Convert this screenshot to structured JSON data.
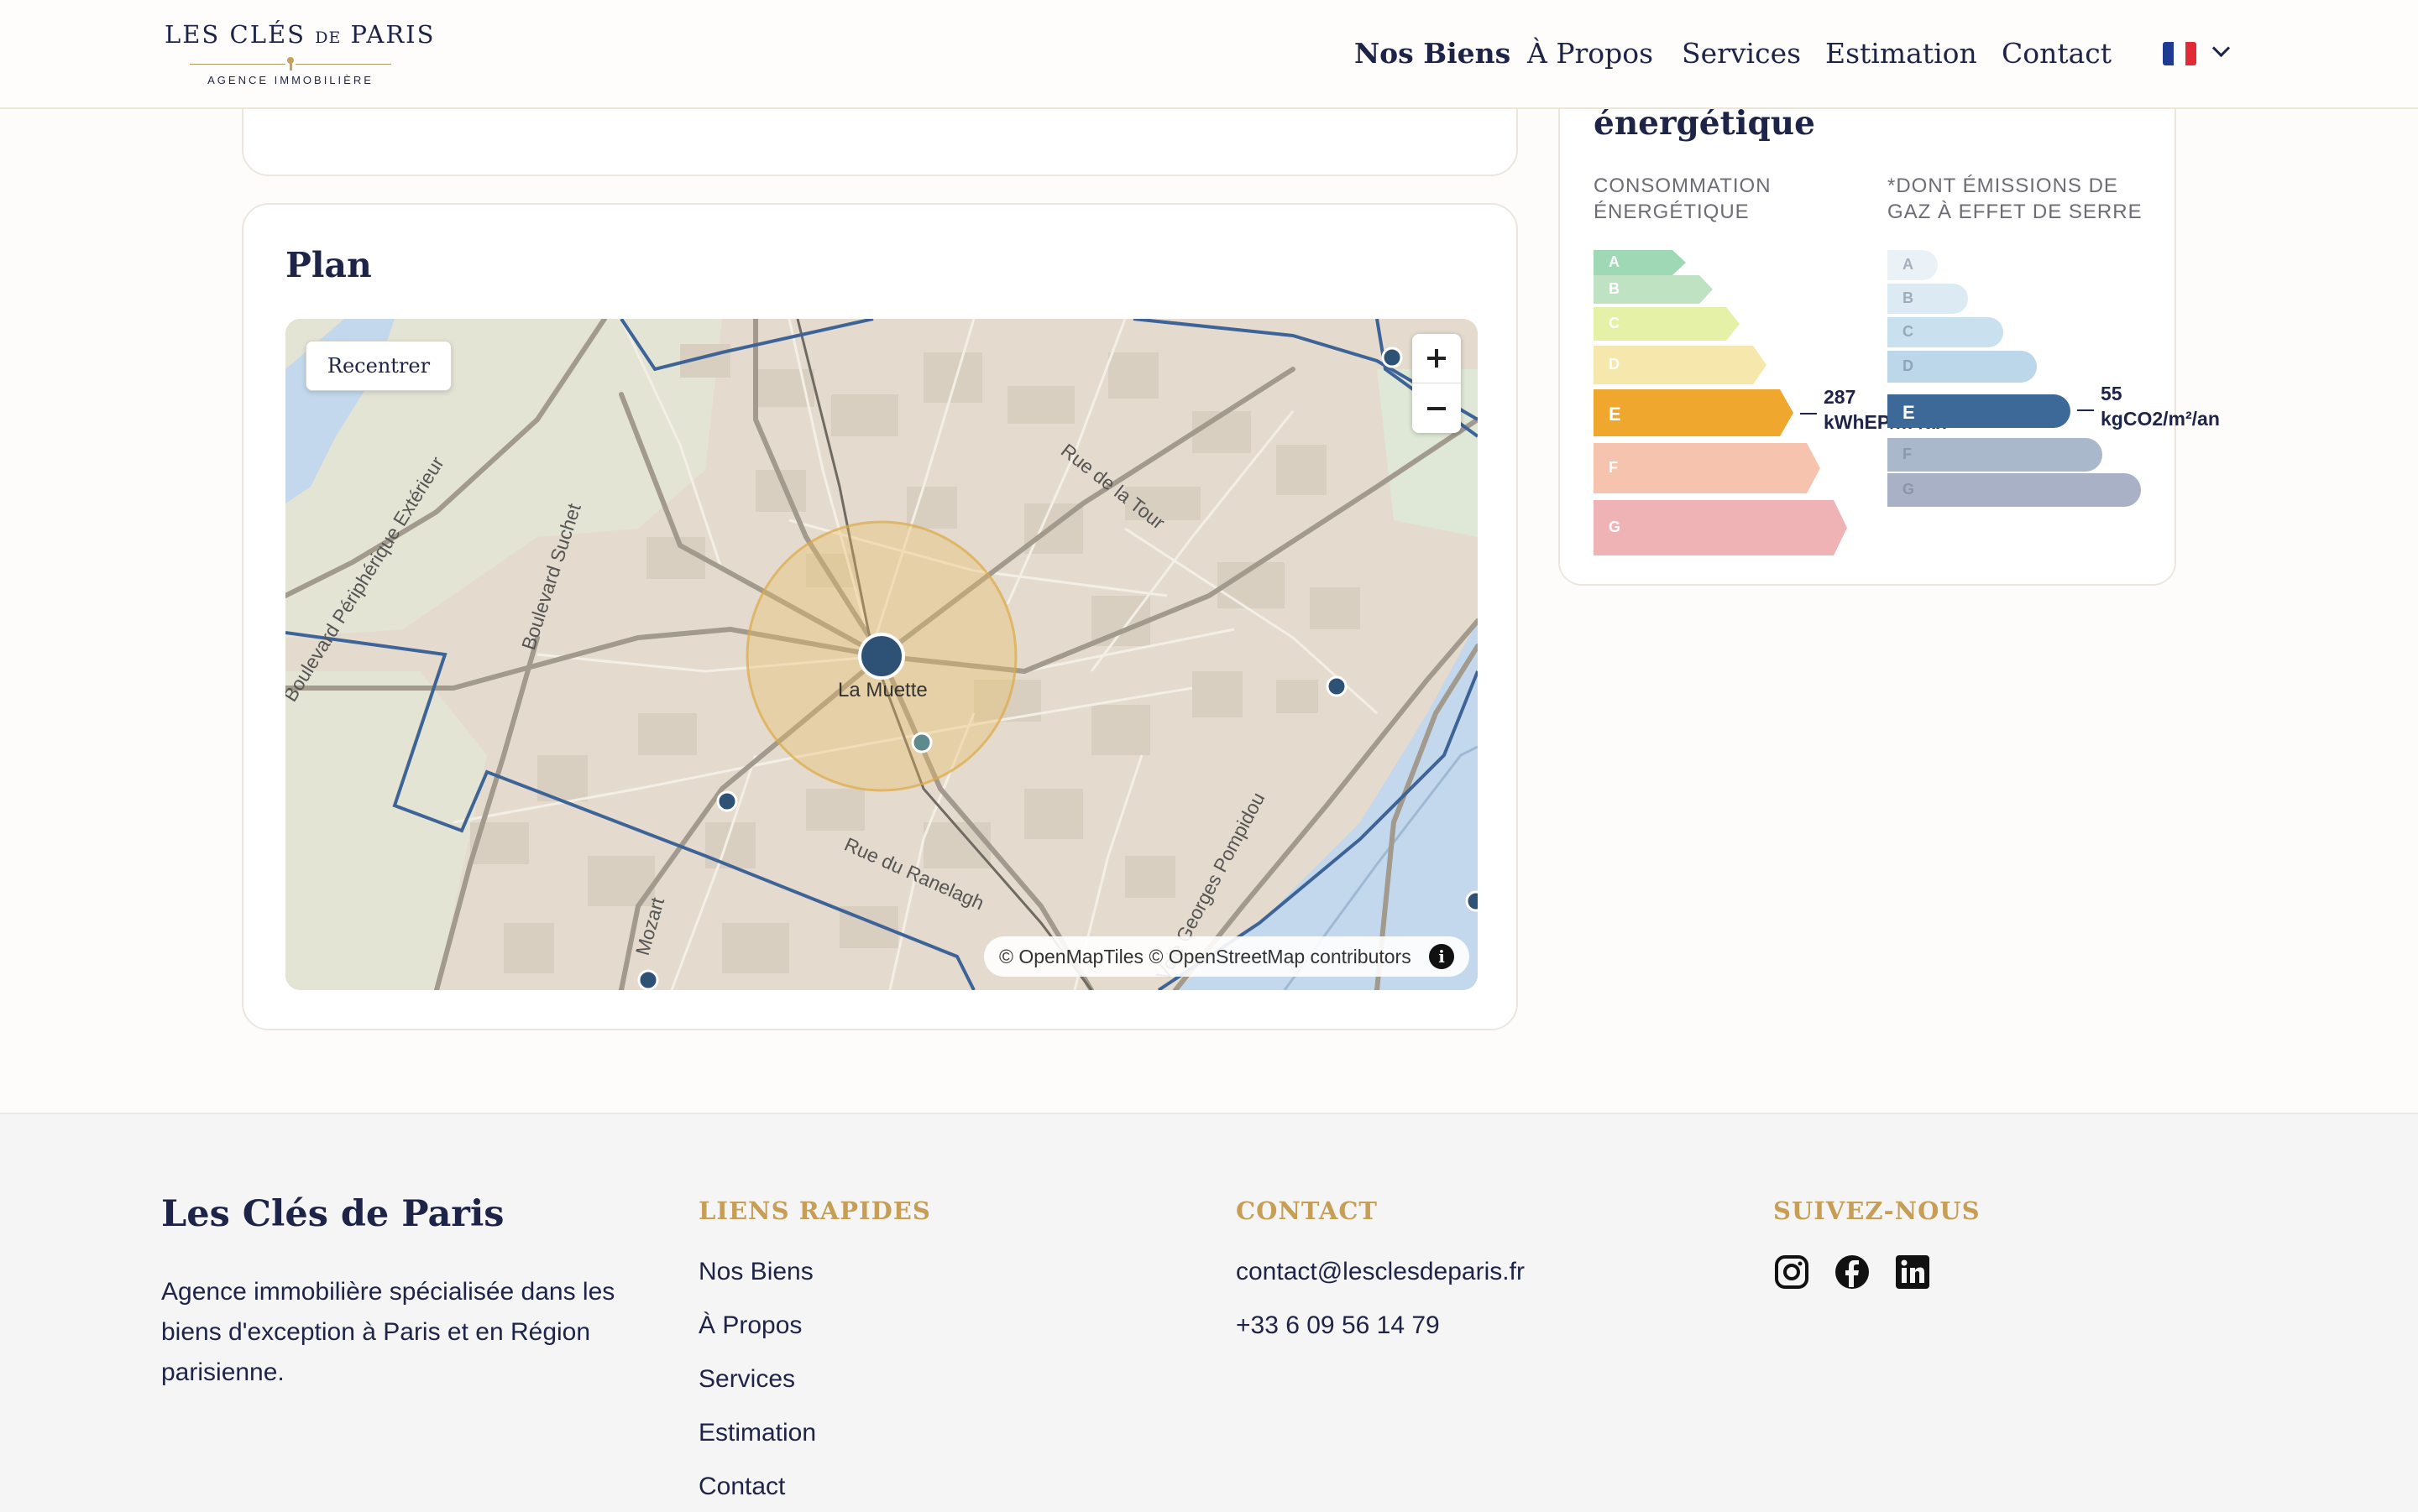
{
  "header": {
    "logo": {
      "line1_a": "LES CLÉS ",
      "line1_b": "DE",
      "line1_c": " PARIS",
      "tagline": "AGENCE IMMOBILIÈRE"
    },
    "nav": [
      {
        "label": "Nos Biens",
        "active": true
      },
      {
        "label": "À Propos"
      },
      {
        "label": "Services"
      },
      {
        "label": "Estimation"
      },
      {
        "label": "Contact"
      }
    ],
    "language": {
      "icon": "flag-fr-icon",
      "colors": [
        "#1f3a93",
        "#ffffff",
        "#e02b36"
      ]
    }
  },
  "plan": {
    "title": "Plan",
    "recenter_label": "Recentrer",
    "place_label": "La Muette",
    "streets": [
      "Boulevard Périphérique Extérieur",
      "Boulevard Suchet",
      "Rue de la Tour",
      "Rue du Ranelagh",
      "Mozart",
      "Voie Georges Pompidou"
    ],
    "attribution": "© OpenMapTiles © OpenStreetMap contributors",
    "info_icon": "i"
  },
  "dpe": {
    "title": "énergétique",
    "energy": {
      "label_line1": "CONSOMMATION",
      "label_line2": "ÉNERGÉTIQUE",
      "classes": [
        "A",
        "B",
        "C",
        "D",
        "E",
        "F",
        "G"
      ],
      "active": "E",
      "value_line1": "287",
      "value_line2": "kWhEP/m²/an",
      "colors": [
        "#9fd8b4",
        "#bfe3c2",
        "#e6f1a8",
        "#f6e7ad",
        "#f0a72e",
        "#f6c4ae",
        "#f0b3b5"
      ]
    },
    "ghg": {
      "label_line1": "*DONT ÉMISSIONS DE",
      "label_line2": "GAZ À EFFET DE SERRE",
      "classes": [
        "A",
        "B",
        "C",
        "D",
        "E",
        "F",
        "G"
      ],
      "active": "E",
      "value_line1": "55",
      "value_line2": "kgCO2/m²/an",
      "colors": [
        "#eaf2f8",
        "#dceaf4",
        "#c9e1ef",
        "#bcd6ea",
        "#3c6997",
        "#aab8cc",
        "#a9b1c6"
      ]
    }
  },
  "footer": {
    "brand": "Les Clés de Paris",
    "description": "Agence immobilière spécialisée dans les biens d'exception à Paris et en Région parisienne.",
    "quick_links_title": "LIENS RAPIDES",
    "quick_links": [
      "Nos Biens",
      "À Propos",
      "Services",
      "Estimation",
      "Contact"
    ],
    "contact_title": "CONTACT",
    "email": "contact@lesclesdeparis.fr",
    "phone": "+33 6 09 56 14 79",
    "social_title": "SUIVEZ-NOUS",
    "social": [
      "instagram-icon",
      "facebook-icon",
      "linkedin-icon"
    ]
  }
}
